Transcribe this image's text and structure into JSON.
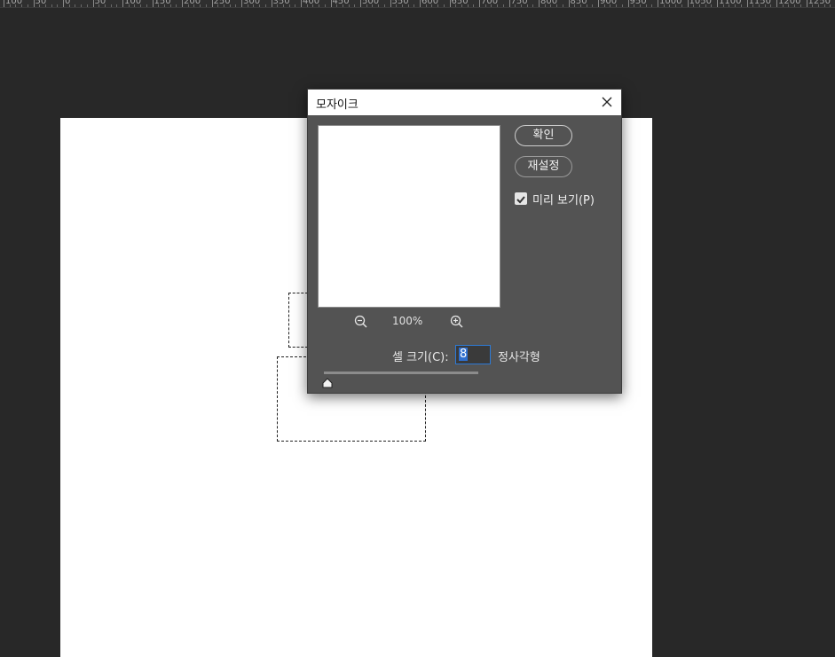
{
  "ruler": {
    "labels": [
      "100",
      "50",
      "0",
      "50",
      "100",
      "150",
      "200",
      "250",
      "300",
      "350",
      "400",
      "450",
      "500",
      "550",
      "600",
      "650",
      "700",
      "750",
      "800",
      "850",
      "900",
      "950",
      "1000",
      "1050",
      "1100",
      "1150",
      "1200",
      "1250"
    ]
  },
  "dialog": {
    "title": "모자이크",
    "ok_label": "확인",
    "reset_label": "재설정",
    "preview_label": "미리 보기(P)",
    "preview_checked": true,
    "zoom_level": "100%",
    "cell_size_label": "셀 크기(C):",
    "cell_size_value": "8",
    "cell_size_unit": "정사각형",
    "slider_value": 8
  },
  "icons": {
    "close": "close-icon",
    "zoom_out": "zoom-out-icon",
    "zoom_in": "zoom-in-icon",
    "checkbox": "checkmark-icon"
  },
  "colors": {
    "workspace": "#282828",
    "dialog_bg": "#535353",
    "input_focus": "#2d7ad6"
  }
}
